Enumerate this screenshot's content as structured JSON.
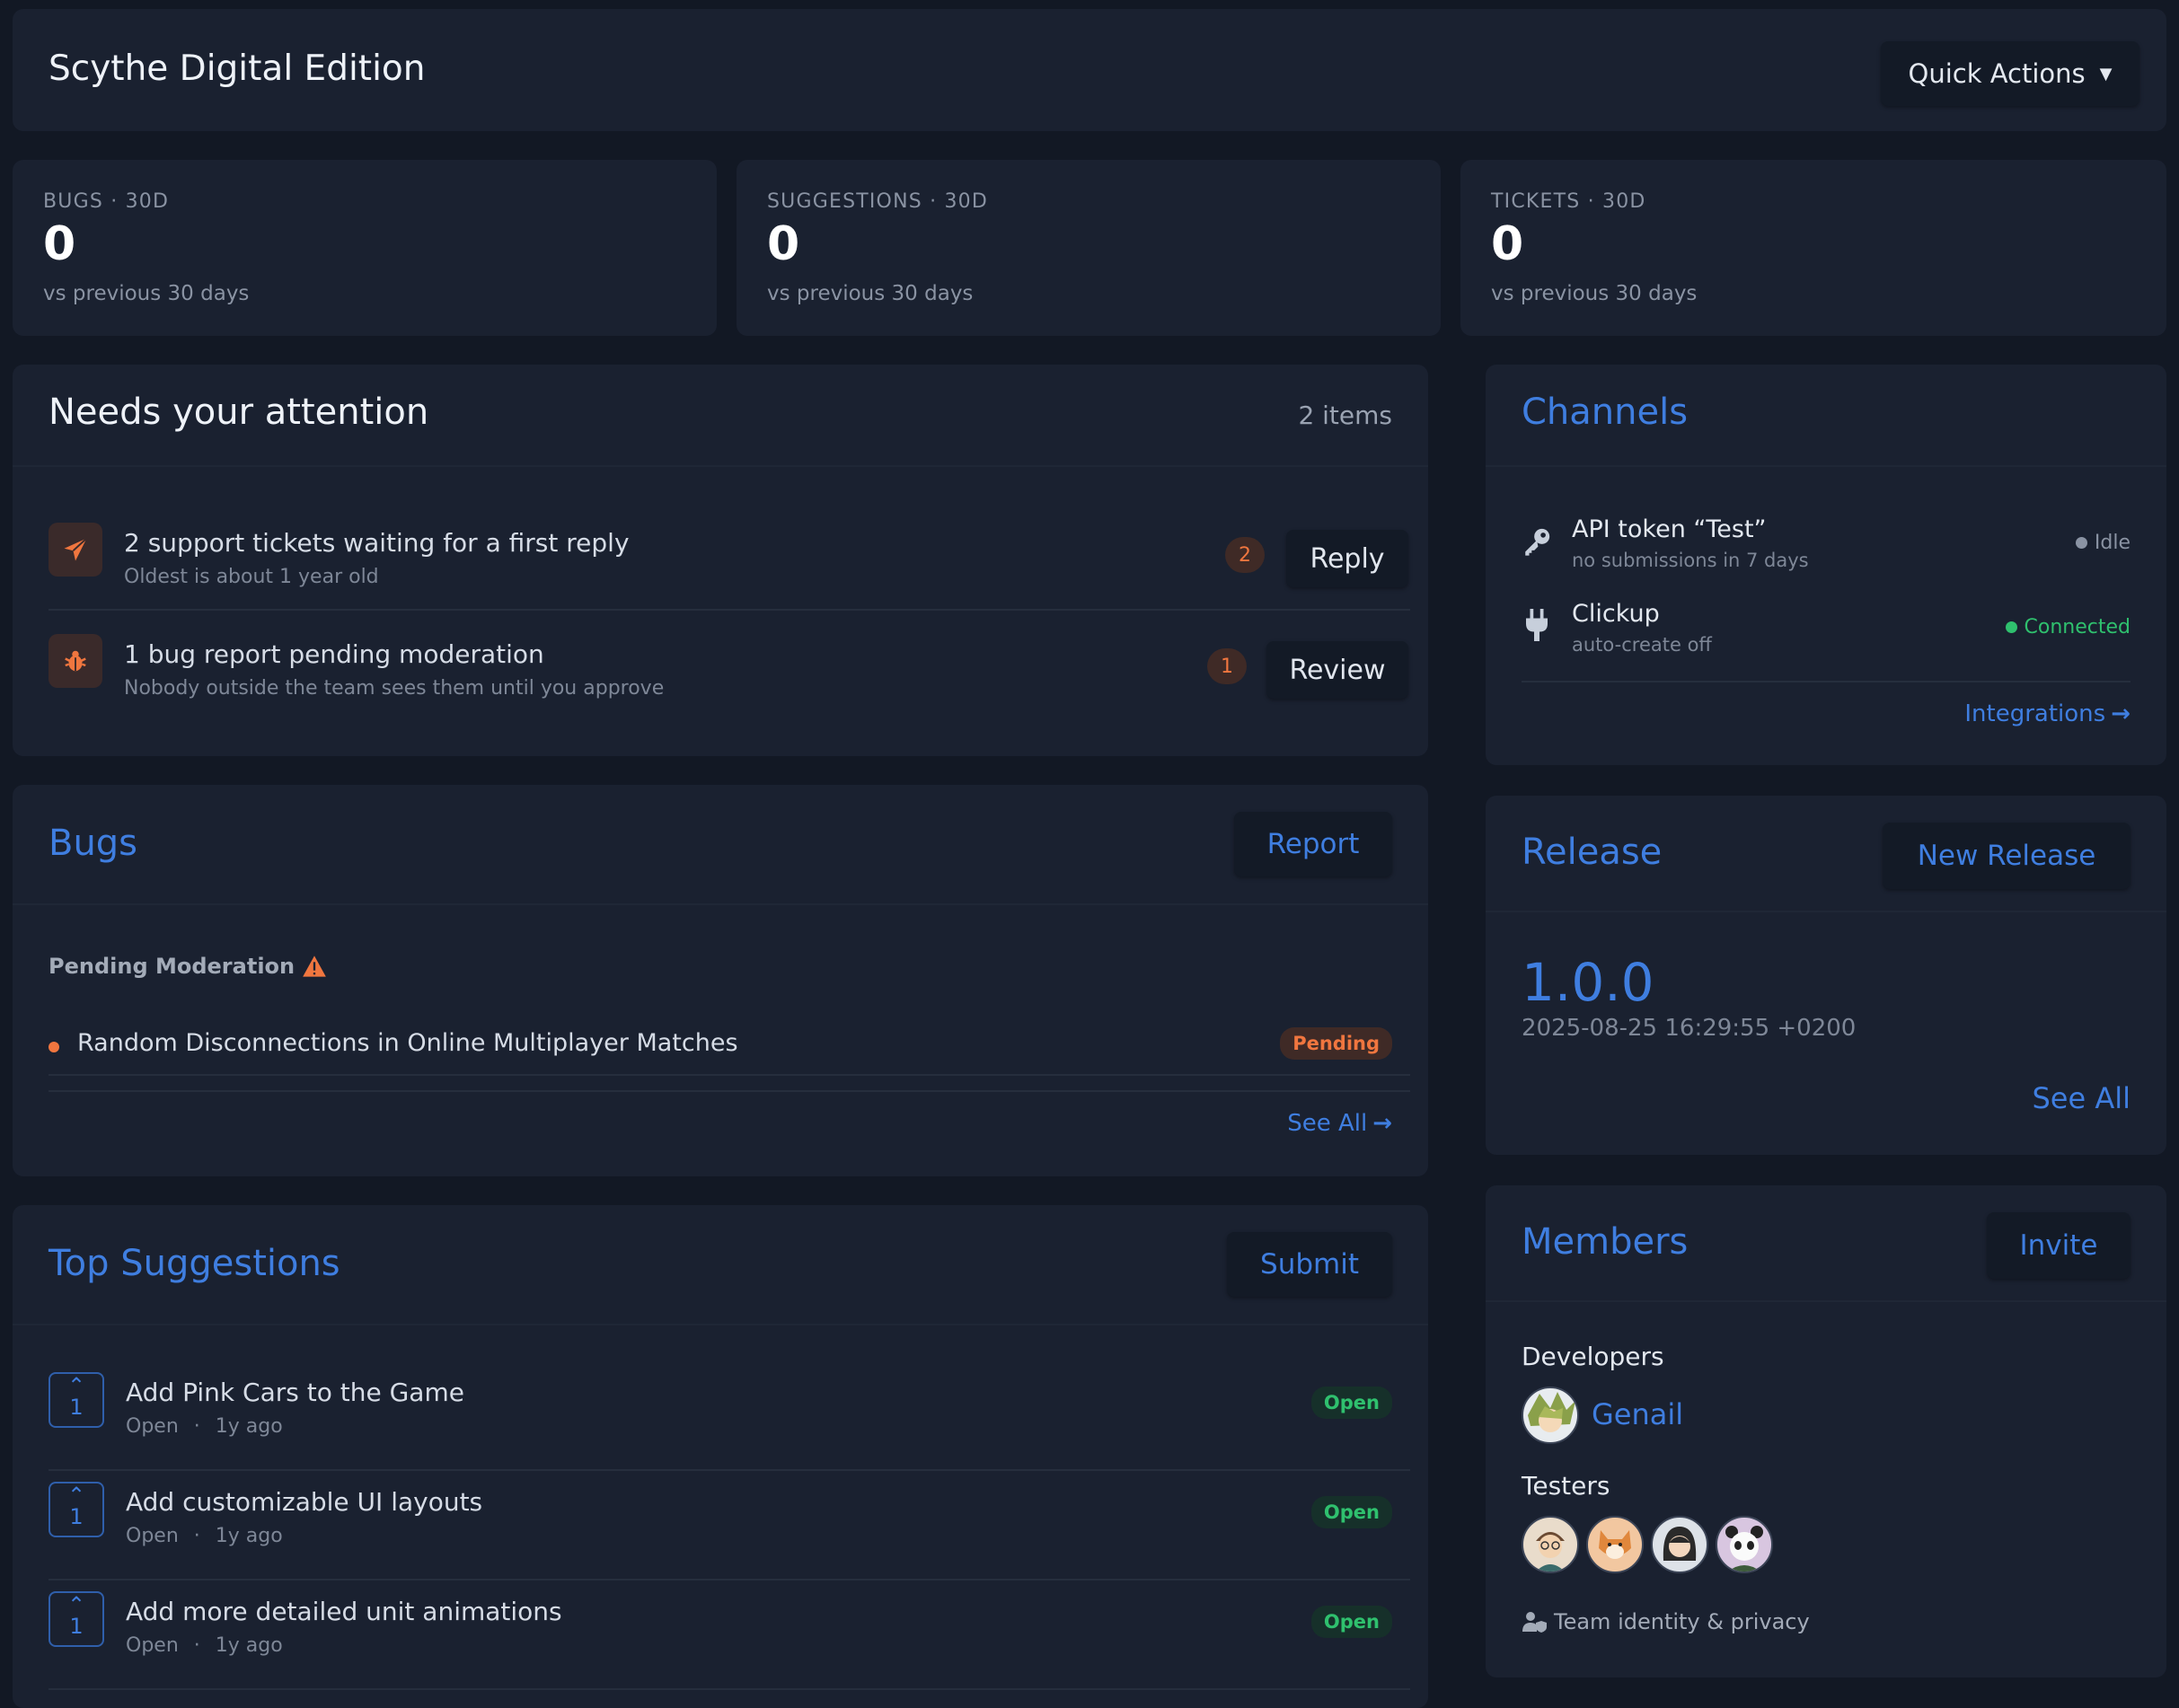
{
  "header": {
    "title": "Scythe Digital Edition",
    "quick_actions_label": "Quick Actions"
  },
  "stats": [
    {
      "label": "BUGS · 30D",
      "value": "0",
      "sub": "vs previous 30 days"
    },
    {
      "label": "SUGGESTIONS · 30D",
      "value": "0",
      "sub": "vs previous 30 days"
    },
    {
      "label": "TICKETS · 30D",
      "value": "0",
      "sub": "vs previous 30 days"
    }
  ],
  "attention": {
    "title": "Needs your attention",
    "count_label": "2 items",
    "items": [
      {
        "icon": "paper-plane-icon",
        "title": "2 support tickets waiting for a first reply",
        "sub": "Oldest is about 1 year old",
        "count": "2",
        "action": "Reply"
      },
      {
        "icon": "bug-icon",
        "title": "1 bug report pending moderation",
        "sub": "Nobody outside the team sees them until you approve",
        "count": "1",
        "action": "Review"
      }
    ]
  },
  "bugs": {
    "title": "Bugs",
    "report_label": "Report",
    "section_label": "Pending Moderation",
    "items": [
      {
        "title": "Random Disconnections in Online Multiplayer Matches",
        "status": "Pending"
      }
    ],
    "see_all_label": "See All"
  },
  "suggestions": {
    "title": "Top Suggestions",
    "submit_label": "Submit",
    "items": [
      {
        "votes": "1",
        "title": "Add Pink Cars to the Game",
        "status": "Open",
        "age": "1y ago",
        "badge": "Open"
      },
      {
        "votes": "1",
        "title": "Add customizable UI layouts",
        "status": "Open",
        "age": "1y ago",
        "badge": "Open"
      },
      {
        "votes": "1",
        "title": "Add more detailed unit animations",
        "status": "Open",
        "age": "1y ago",
        "badge": "Open"
      }
    ]
  },
  "channels": {
    "title": "Channels",
    "items": [
      {
        "icon": "key-icon",
        "name": "API token “Test”",
        "sub": "no submissions in 7 days",
        "status": "Idle",
        "status_color": "#8a93a3"
      },
      {
        "icon": "plug-icon",
        "name": "Clickup",
        "sub": "auto-create off",
        "status": "Connected",
        "status_color": "#2fc06e"
      }
    ],
    "integrations_label": "Integrations"
  },
  "release": {
    "title": "Release",
    "new_release_label": "New Release",
    "version": "1.0.0",
    "date": "2025-08-25 16:29:55 +0200",
    "see_all_label": "See All"
  },
  "members": {
    "title": "Members",
    "invite_label": "Invite",
    "developers_label": "Developers",
    "developer_name": "Genail",
    "testers_label": "Testers",
    "testers": [
      "tester-avatar-glasses",
      "tester-avatar-shiba",
      "tester-avatar-girl",
      "tester-avatar-panda"
    ],
    "privacy_label": "Team identity & privacy"
  },
  "colors": {
    "accent": "#3f7ee0",
    "warning": "#f0763f",
    "success": "#2fc06e",
    "background": "#121824",
    "card": "#1a2130"
  }
}
